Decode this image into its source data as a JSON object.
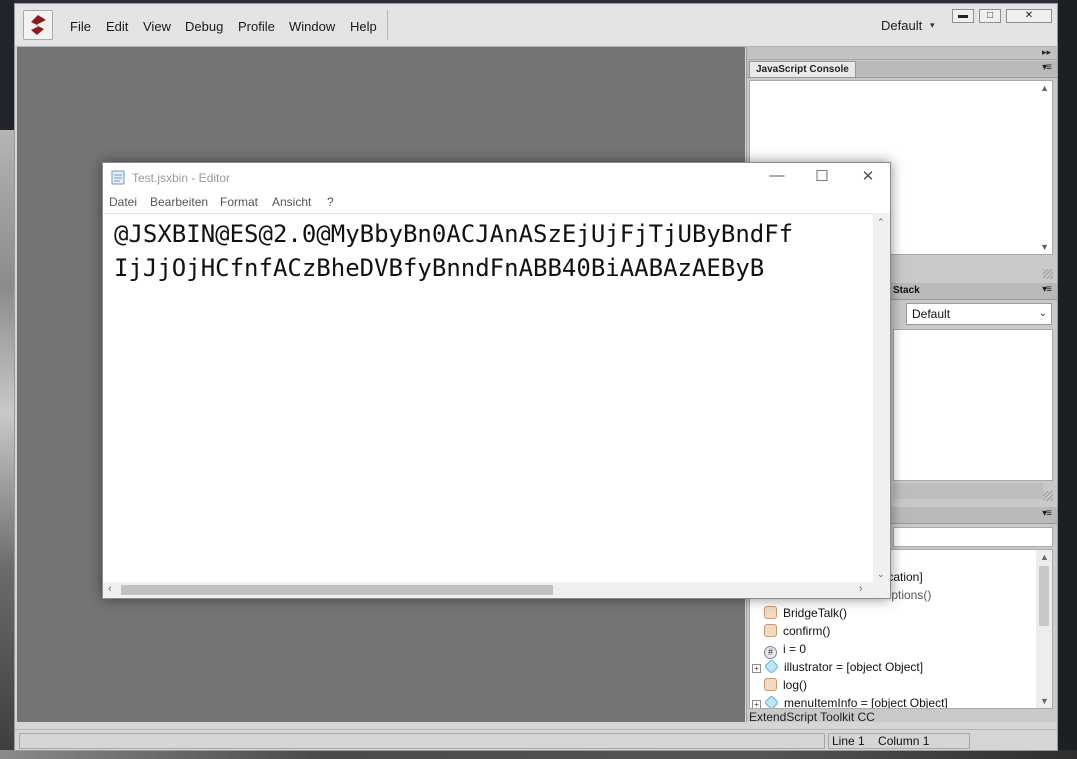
{
  "app": {
    "menu": [
      "File",
      "Edit",
      "View",
      "Debug",
      "Profile",
      "Window",
      "Help"
    ],
    "workspace": "Default",
    "window_buttons": {
      "minimize": "▬",
      "maximize": "□",
      "close": "✕"
    }
  },
  "panels": {
    "console_tab": "JavaScript Console",
    "stack_tab": "Stack",
    "stack_select": "Default",
    "data_browser_items": [
      {
        "label": "lication]"
      },
      {
        "label": "Options()"
      },
      {
        "label": "BridgeTalk()"
      },
      {
        "label": "confirm()"
      },
      {
        "label": "i = 0"
      },
      {
        "label": "illustrator = [object Object]"
      },
      {
        "label": "log()"
      },
      {
        "label": "menuItemInfo = [object Object]"
      }
    ],
    "footer_label": "ExtendScript Toolkit CC"
  },
  "status": {
    "line": "Line 1",
    "column": "Column 1"
  },
  "notepad": {
    "title": "Test.jsxbin - Editor",
    "menu": [
      "Datei",
      "Bearbeiten",
      "Format",
      "Ansicht",
      "?"
    ],
    "content_lines": [
      "@JSXBIN@ES@2.0@MyBbyBn0ACJAnASzEjUjFjTjUByBndFf",
      "IjJjOjHCfnfACzBheDVBfyBnndFnABB40BiAABAzAEByB"
    ],
    "controls": {
      "minimize": "—",
      "maximize": "☐",
      "close": "✕"
    }
  }
}
